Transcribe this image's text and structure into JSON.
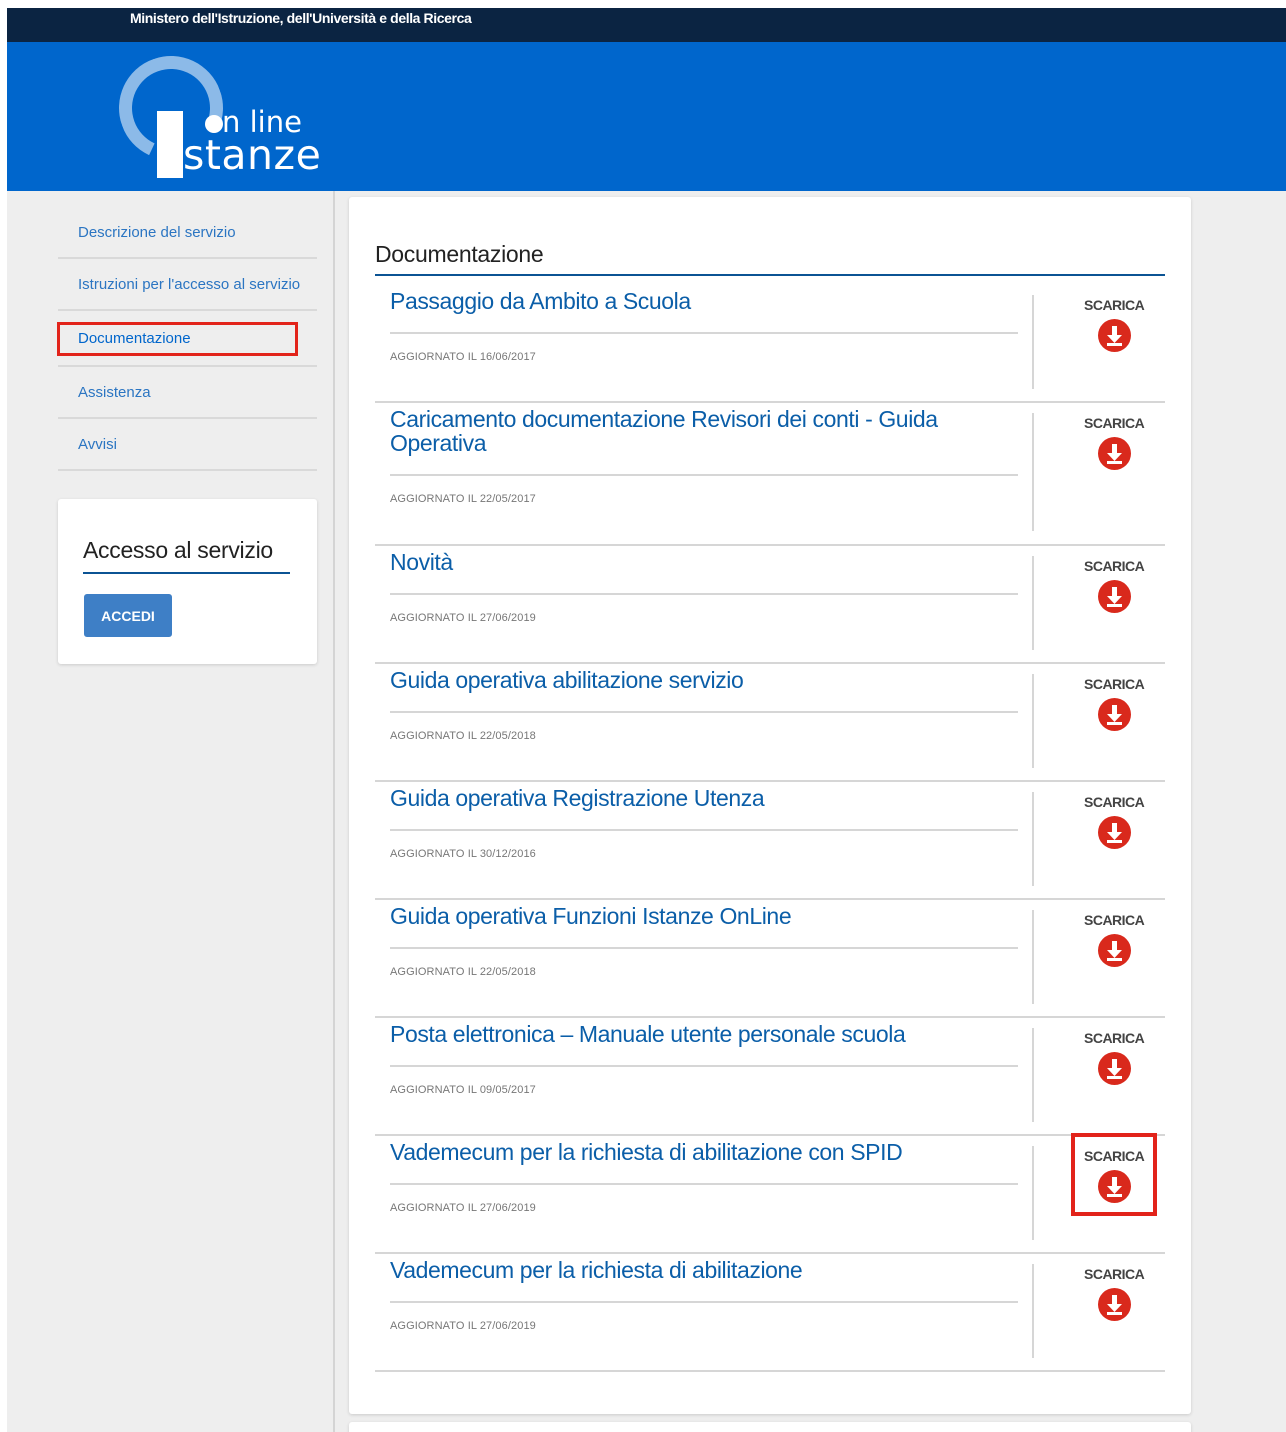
{
  "header": {
    "ministry": "Ministero dell'Istruzione, dell'Università e della Ricerca",
    "logo_online": "On line",
    "logo_istanze": "Istanze"
  },
  "sidebar": {
    "items": [
      {
        "label": "Descrizione del servizio"
      },
      {
        "label": "Istruzioni per l'accesso al servizio"
      },
      {
        "label": "Documentazione"
      },
      {
        "label": "Assistenza"
      },
      {
        "label": "Avvisi"
      }
    ],
    "access": {
      "title": "Accesso al servizio",
      "button": "ACCEDI"
    }
  },
  "main": {
    "title": "Documentazione",
    "download_label": "SCARICA",
    "documents": [
      {
        "title": "Passaggio da Ambito a Scuola",
        "date": "AGGIORNATO IL 16/06/2017"
      },
      {
        "title": "Caricamento documentazione Revisori dei conti - Guida Operativa",
        "date": "AGGIORNATO IL 22/05/2017"
      },
      {
        "title": "Novità",
        "date": "AGGIORNATO IL 27/06/2019"
      },
      {
        "title": "Guida operativa abilitazione servizio",
        "date": "AGGIORNATO IL 22/05/2018"
      },
      {
        "title": "Guida operativa Registrazione Utenza",
        "date": "AGGIORNATO IL 30/12/2016"
      },
      {
        "title": "Guida operativa Funzioni Istanze OnLine",
        "date": "AGGIORNATO IL 22/05/2018"
      },
      {
        "title": "Posta elettronica – Manuale utente personale scuola",
        "date": "AGGIORNATO IL 09/05/2017"
      },
      {
        "title": "Vademecum per la richiesta di abilitazione con SPID",
        "date": "AGGIORNATO IL 27/06/2019"
      },
      {
        "title": "Vademecum per la richiesta di abilitazione",
        "date": "AGGIORNATO IL 27/06/2019"
      }
    ]
  },
  "colors": {
    "brand_blue": "#0066cc",
    "top_bar": "#0b2442",
    "download_red": "#d9291c",
    "highlight_red": "#e2231a"
  }
}
